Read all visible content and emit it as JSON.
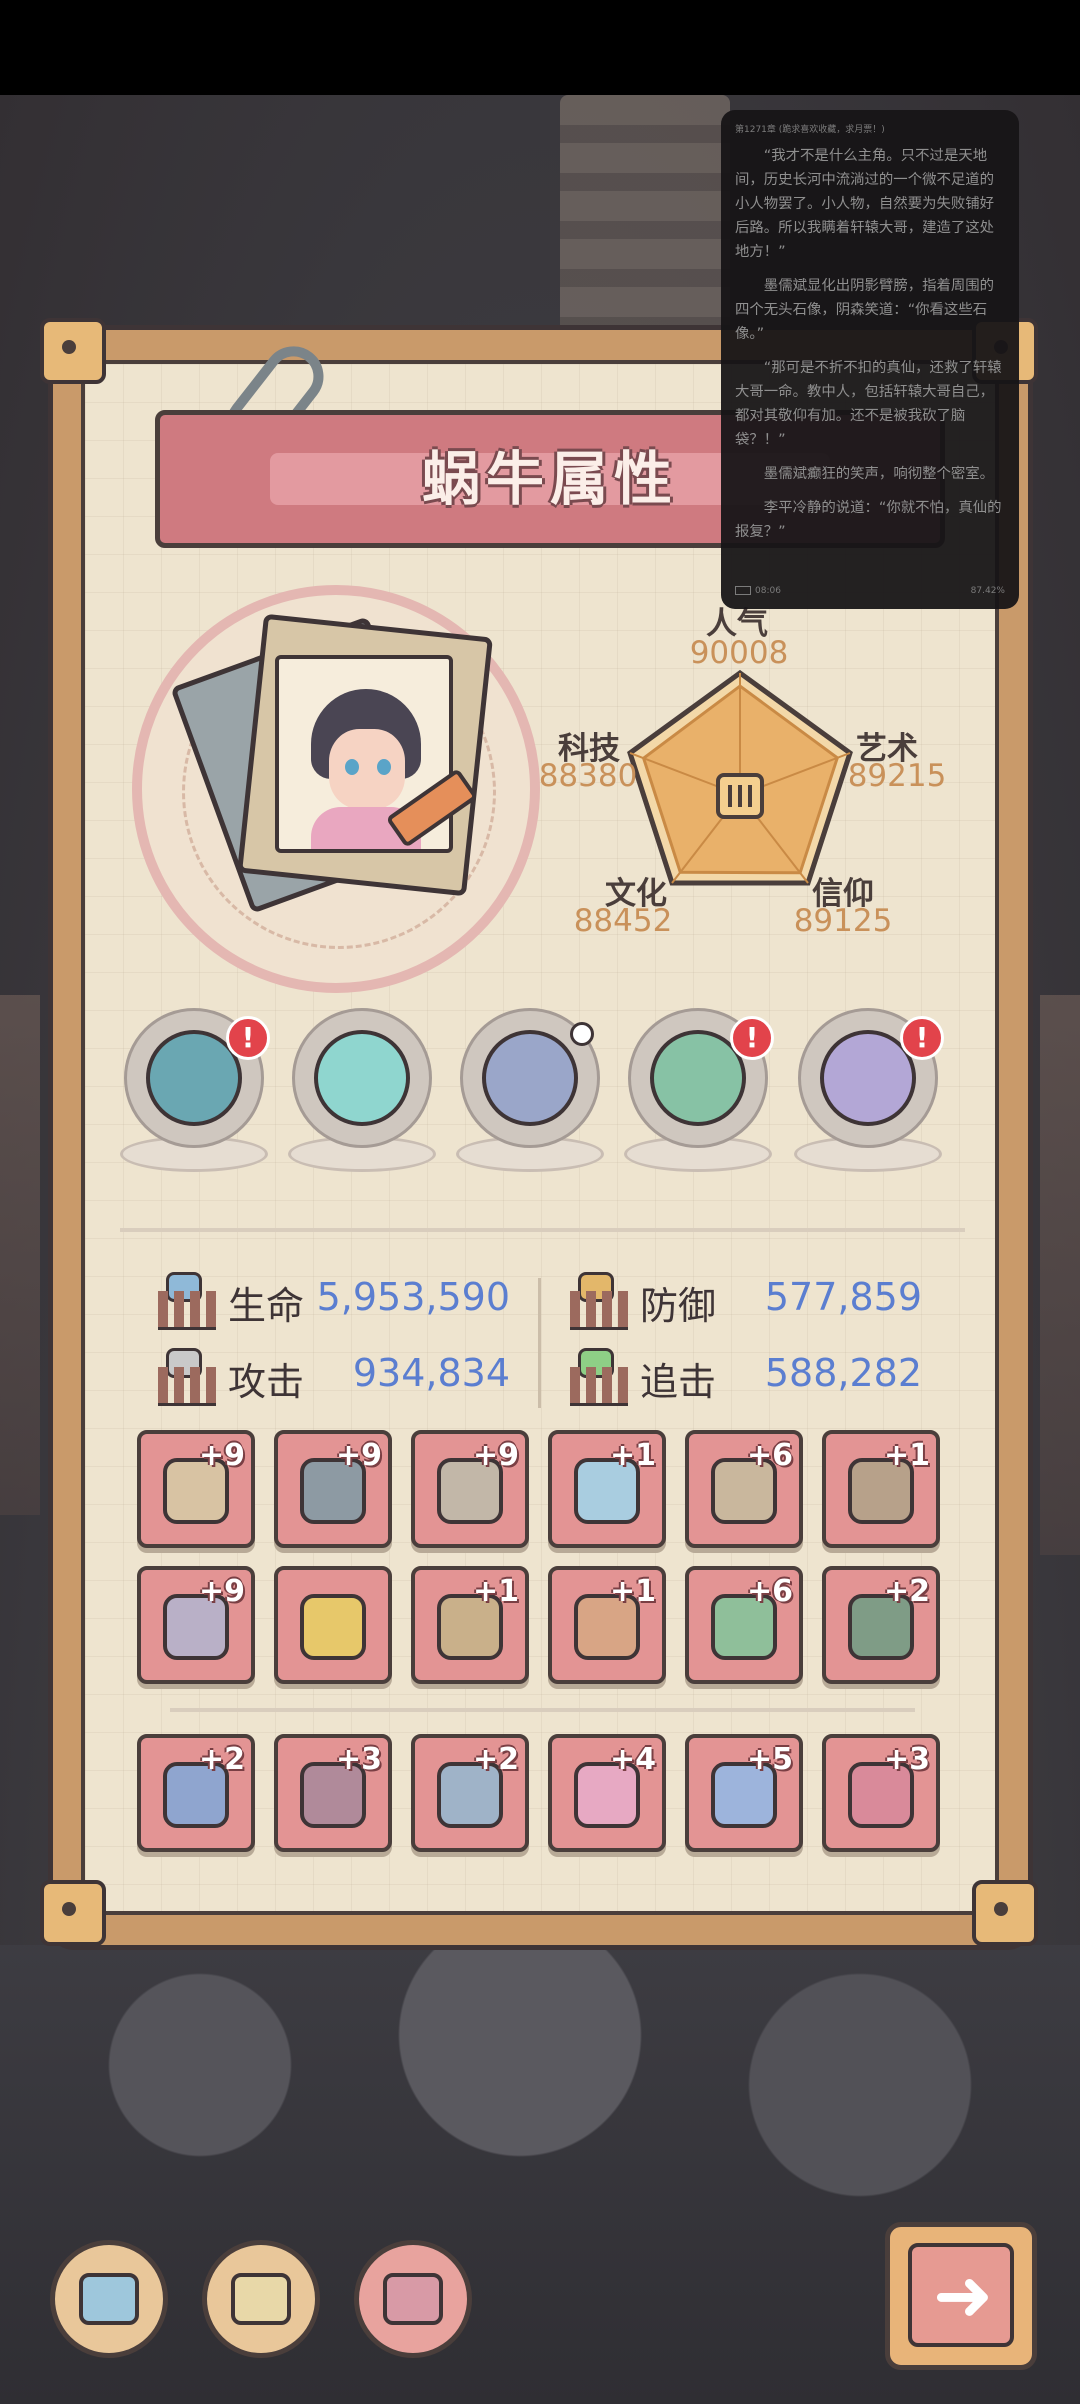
{
  "panel": {
    "title": "蜗牛属性"
  },
  "radar": {
    "axes": [
      {
        "key": "popularity",
        "label": "人气",
        "value": "90008"
      },
      {
        "key": "art",
        "label": "艺术",
        "value": "89215"
      },
      {
        "key": "belief",
        "label": "信仰",
        "value": "89125"
      },
      {
        "key": "culture",
        "label": "文化",
        "value": "88452"
      },
      {
        "key": "tech",
        "label": "科技",
        "value": "88380"
      }
    ]
  },
  "orbs": [
    {
      "name": "fanged-monster-orb",
      "color": "#6aa7b2",
      "badge": "!"
    },
    {
      "name": "spiral-shell-orb",
      "color": "#8fd6cf",
      "badge": ""
    },
    {
      "name": "compass-orb",
      "color": "#9aa6c9",
      "badge": ""
    },
    {
      "name": "green-swirl-orb",
      "color": "#87c2a5",
      "badge": "!"
    },
    {
      "name": "gem-cluster-orb",
      "color": "#b3a7d6",
      "badge": "!"
    }
  ],
  "stats": {
    "hp_label": "生命",
    "hp_value": "5,953,590",
    "def_label": "防御",
    "def_value": "577,859",
    "atk_label": "攻击",
    "atk_value": "934,834",
    "chase_label": "追击",
    "chase_value": "588,282"
  },
  "equipment": {
    "row1": [
      "+9",
      "+9",
      "+9",
      "+1",
      "+6",
      "+1"
    ],
    "row2": [
      "+9",
      "",
      "+1",
      "+1",
      "+6",
      "+2"
    ],
    "row3": [
      "+2",
      "+3",
      "+2",
      "+4",
      "+5",
      "+3"
    ]
  },
  "reader": {
    "header": "第1271章 (跪求喜欢收藏，求月票！)",
    "paragraphs": [
      "“我才不是什么主角。只不过是天地间，历史长河中流淌过的一个微不足道的小人物罢了。小人物，自然要为失败铺好后路。所以我瞒着轩辕大哥，建造了这处地方！”",
      "墨儒斌显化出阴影臂膀，指着周围的四个无头石像，阴森笑道：“你看这些石像。”",
      "“那可是不折不扣的真仙，还救了轩辕大哥一命。教中人，包括轩辕大哥自己，都对其敬仰有加。还不是被我砍了脑袋？！”",
      "墨儒斌癫狂的笑声，响彻整个密室。",
      "李平冷静的说道：“你就不怕，真仙的报复？”"
    ],
    "time": "08:06",
    "progress": "87.42%"
  },
  "colors": {
    "panel_accent": "#cf7a80",
    "value_blue": "#5b7ed0",
    "radar_fill": "#e9b16a"
  }
}
